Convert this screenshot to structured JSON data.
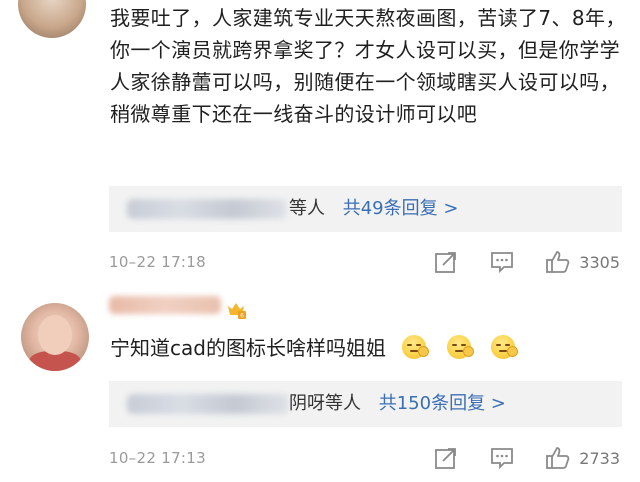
{
  "comments": [
    {
      "text": "我要吐了，人家建筑专业天天熬夜画图，苦读了7、8年，你一个演员就跨界拿奖了？才女人设可以买，但是你学学人家徐静蕾可以吗，别随便在一个领域瞎买人设可以吗，稍微尊重下还在一线奋斗的设计师可以吧",
      "reply_suffix": "等人",
      "reply_count_label": "共49条回复 >",
      "timestamp": "10–22 17:18",
      "likes": "3305"
    },
    {
      "text": "宁知道cad的图标长啥样吗姐姐",
      "reply_suffix": "阴呀等人",
      "reply_count_label": "共150条回复 >",
      "timestamp": "10–22 17:13",
      "likes": "2733"
    }
  ],
  "icons": {
    "share": "share-icon",
    "comment": "comment-icon",
    "like": "thumbs-up-icon",
    "emoji": "smirk-emoji-icon",
    "badge": "vip-badge-icon"
  },
  "colors": {
    "link": "#3a6fb5",
    "meta": "#9a9a9a",
    "reply_bg": "#f2f2f2"
  }
}
